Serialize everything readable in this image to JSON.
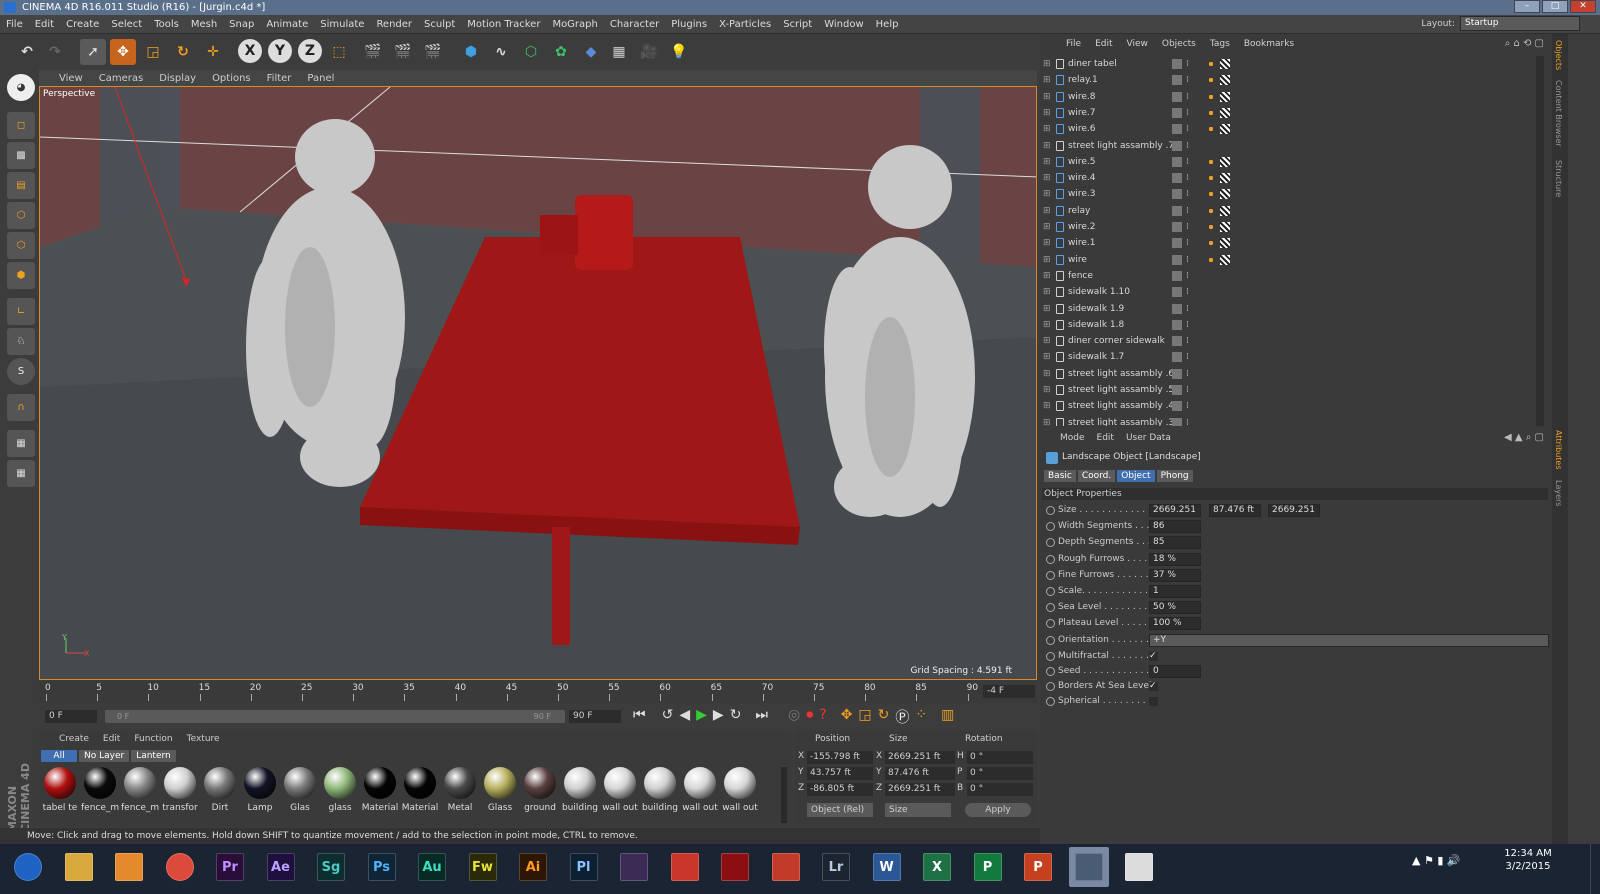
{
  "window": {
    "title": "CINEMA 4D R16.011 Studio (R16) - [Jurgin.c4d *]"
  },
  "menubar": [
    "File",
    "Edit",
    "Create",
    "Select",
    "Tools",
    "Mesh",
    "Snap",
    "Animate",
    "Simulate",
    "Render",
    "Sculpt",
    "Motion Tracker",
    "MoGraph",
    "Character",
    "Plugins",
    "X-Particles",
    "Script",
    "Window",
    "Help"
  ],
  "layout": {
    "label": "Layout:",
    "value": "Startup"
  },
  "viewport": {
    "menu": [
      "View",
      "Cameras",
      "Display",
      "Options",
      "Filter",
      "Panel"
    ],
    "camera_label": "Perspective",
    "grid_spacing": "Grid Spacing : 4.591 ft",
    "axis_y": "Y",
    "axis_x": "X"
  },
  "timeline": {
    "ticks": [
      "0",
      "5",
      "10",
      "15",
      "20",
      "25",
      "30",
      "35",
      "40",
      "45",
      "50",
      "55",
      "60",
      "65",
      "70",
      "75",
      "80",
      "85",
      "90"
    ],
    "current_frame_readout": "-4 F",
    "start": "0 F",
    "range_start": "0 F",
    "range_end": "90 F",
    "end": "90 F"
  },
  "materials": {
    "menu": [
      "Create",
      "Edit",
      "Function",
      "Texture"
    ],
    "filters": [
      "All",
      "No Layer",
      "Lantern"
    ],
    "items": [
      {
        "label": "tabel te",
        "color": "#b01010"
      },
      {
        "label": "fence_m",
        "color": "#0a0a0a"
      },
      {
        "label": "fence_m",
        "color": "#888888"
      },
      {
        "label": "transfor",
        "color": "#cfcfcf"
      },
      {
        "label": "Dirt",
        "color": "#777777"
      },
      {
        "label": "Lamp",
        "color": "#121424"
      },
      {
        "label": "Glas",
        "color": "#7a7a7a"
      },
      {
        "label": "glass",
        "color": "#8fb87a"
      },
      {
        "label": "Material",
        "color": "#050505"
      },
      {
        "label": "Material",
        "color": "#050505"
      },
      {
        "label": "Metal",
        "color": "#4a4a4a"
      },
      {
        "label": "Glass",
        "color": "#b7b060"
      },
      {
        "label": "ground",
        "color": "#5a4040"
      },
      {
        "label": "building",
        "color": "#d0d0d0"
      },
      {
        "label": "wall out",
        "color": "#d6d6d6"
      },
      {
        "label": "building",
        "color": "#d0d0d0"
      },
      {
        "label": "wall out",
        "color": "#d6d6d6"
      },
      {
        "label": "wall out",
        "color": "#d6d6d6"
      }
    ]
  },
  "coords": {
    "headers": [
      "Position",
      "Size",
      "Rotation"
    ],
    "rows": [
      {
        "axis": "X",
        "pos": "-155.798 ft",
        "size_axis": "X",
        "size": "2669.251 ft",
        "rot_axis": "H",
        "rot": "0 °"
      },
      {
        "axis": "Y",
        "pos": "43.757 ft",
        "size_axis": "Y",
        "size": "87.476 ft",
        "rot_axis": "P",
        "rot": "0 °"
      },
      {
        "axis": "Z",
        "pos": "-86.805 ft",
        "size_axis": "Z",
        "size": "2669.251 ft",
        "rot_axis": "B",
        "rot": "0 °"
      }
    ],
    "mode_select": "Object (Rel)",
    "size_select": "Size",
    "apply": "Apply"
  },
  "status": "Move: Click and drag to move elements. Hold down SHIFT to quantize movement / add to the selection in point mode, CTRL to remove.",
  "object_manager": {
    "menu": [
      "File",
      "Edit",
      "View",
      "Objects",
      "Tags",
      "Bookmarks"
    ],
    "objects": [
      {
        "name": "diner tabel",
        "icon": "null",
        "tags": true
      },
      {
        "name": "relay.1",
        "icon": "cyl",
        "tags": true
      },
      {
        "name": "wire.8",
        "icon": "spline",
        "tags": true
      },
      {
        "name": "wire.7",
        "icon": "spline",
        "tags": true
      },
      {
        "name": "wire.6",
        "icon": "spline",
        "tags": true
      },
      {
        "name": "street light assambly .7",
        "icon": "null",
        "tags": false
      },
      {
        "name": "wire.5",
        "icon": "spline",
        "tags": true
      },
      {
        "name": "wire.4",
        "icon": "spline",
        "tags": true
      },
      {
        "name": "wire.3",
        "icon": "spline",
        "tags": true
      },
      {
        "name": "relay",
        "icon": "cyl",
        "tags": true
      },
      {
        "name": "wire.2",
        "icon": "spline",
        "tags": true
      },
      {
        "name": "wire.1",
        "icon": "spline",
        "tags": true
      },
      {
        "name": "wire",
        "icon": "spline",
        "tags": true
      },
      {
        "name": "fence",
        "icon": "null",
        "tags": false
      },
      {
        "name": "sidewalk 1.10",
        "icon": "null",
        "tags": false
      },
      {
        "name": "sidewalk 1.9",
        "icon": "null",
        "tags": false
      },
      {
        "name": "sidewalk 1.8",
        "icon": "null",
        "tags": false
      },
      {
        "name": "diner corner sidewalk",
        "icon": "null",
        "tags": false
      },
      {
        "name": "sidewalk 1.7",
        "icon": "null",
        "tags": false
      },
      {
        "name": "street light assambly .6",
        "icon": "null",
        "tags": false
      },
      {
        "name": "street light assambly .5",
        "icon": "null",
        "tags": false
      },
      {
        "name": "street light assambly .4",
        "icon": "null",
        "tags": false
      },
      {
        "name": "street light assambly .3",
        "icon": "null",
        "tags": false
      }
    ]
  },
  "attributes": {
    "menu": [
      "Mode",
      "Edit",
      "User Data"
    ],
    "object_title": "Landscape Object [Landscape]",
    "tabs": [
      "Basic",
      "Coord.",
      "Object",
      "Phong"
    ],
    "active_tab": "Object",
    "section": "Object Properties",
    "fields": [
      {
        "label": "Size . . . . . . . . . . . . . .",
        "value": "2669.251",
        "extra": [
          "87.476 ft",
          "2669.251"
        ]
      },
      {
        "label": "Width Segments . . .",
        "value": "86"
      },
      {
        "label": "Depth Segments . . .",
        "value": "85"
      },
      {
        "label": "Rough Furrows . . . .",
        "value": "18 %"
      },
      {
        "label": "Fine Furrows . . . . . .",
        "value": "37 %"
      },
      {
        "label": "Scale. . . . . . . . . . . . .",
        "value": "1"
      },
      {
        "label": "Sea Level . . . . . . . . .",
        "value": "50 %"
      },
      {
        "label": "Plateau Level . . . . . .",
        "value": "100 %"
      },
      {
        "label": "Orientation . . . . . . . .",
        "value": "+Y",
        "wide": true
      },
      {
        "label": "Multifractal . . . . . . .",
        "check": true
      },
      {
        "label": "Seed . . . . . . . . . . . . .",
        "value": "0"
      },
      {
        "label": "Borders At Sea Level",
        "check": true
      },
      {
        "label": "Spherical . . . . . . . . .",
        "check": false
      }
    ]
  },
  "right_strip_tabs": [
    "Objects",
    "Content Browser",
    "Structure",
    "Attributes",
    "Layers"
  ],
  "taskbar": {
    "apps": [
      {
        "label": "",
        "color": "#1e63c2",
        "name": "start"
      },
      {
        "label": "",
        "color": "#d9a93d",
        "name": "explorer"
      },
      {
        "label": "",
        "color": "#e38b2c",
        "name": "media"
      },
      {
        "label": "",
        "color": "#dc4a3b",
        "name": "chrome"
      },
      {
        "label": "Pr",
        "color": "#2a0e3a",
        "fg": "#c48dff",
        "name": "premiere"
      },
      {
        "label": "Ae",
        "color": "#1f0f3e",
        "fg": "#b9a3ff",
        "name": "after-effects"
      },
      {
        "label": "Sg",
        "color": "#0c2e2e",
        "fg": "#4ec8c8",
        "name": "speedgrade"
      },
      {
        "label": "Ps",
        "color": "#0e2437",
        "fg": "#4fb1ff",
        "name": "photoshop"
      },
      {
        "label": "Au",
        "color": "#062b25",
        "fg": "#3fdcc2",
        "name": "audition"
      },
      {
        "label": "Fw",
        "color": "#2b2a08",
        "fg": "#e6e23a",
        "name": "fireworks"
      },
      {
        "label": "Ai",
        "color": "#2d1604",
        "fg": "#ff9a1c",
        "name": "illustrator"
      },
      {
        "label": "Pl",
        "color": "#0d1f33",
        "fg": "#8cc4ff",
        "name": "prelude"
      },
      {
        "label": "",
        "color": "#3b2b55",
        "name": "app-13"
      },
      {
        "label": "",
        "color": "#c9342b",
        "name": "acrobat"
      },
      {
        "label": "",
        "color": "#8d0e12",
        "name": "acrobat-distiller"
      },
      {
        "label": "",
        "color": "#c23b2a",
        "name": "davinci"
      },
      {
        "label": "Lr",
        "color": "#1c2430",
        "fg": "#b8cbe0",
        "name": "lightroom"
      },
      {
        "label": "W",
        "color": "#2b5797",
        "fg": "#fff",
        "name": "word"
      },
      {
        "label": "X",
        "color": "#1e7145",
        "fg": "#fff",
        "name": "excel"
      },
      {
        "label": "P",
        "color": "#127a3c",
        "fg": "#fff",
        "name": "publisher"
      },
      {
        "label": "P",
        "color": "#c5401f",
        "fg": "#fff",
        "name": "powerpoint"
      },
      {
        "label": "",
        "color": "#4a5b74",
        "name": "cinema4d",
        "active": true
      },
      {
        "label": "",
        "color": "#dcdcdc",
        "name": "app-last"
      }
    ],
    "time": "12:34 AM",
    "date": "3/2/2015"
  }
}
